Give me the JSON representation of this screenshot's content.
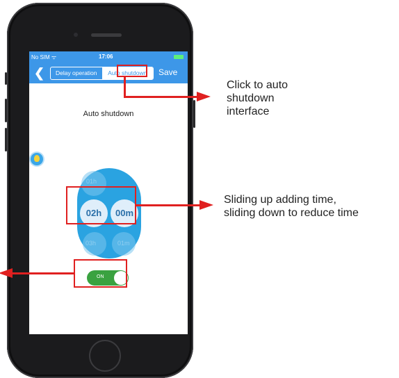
{
  "status_bar": {
    "carrier": "No SIM ᯤ",
    "time": "17:06"
  },
  "nav": {
    "tabs": [
      "Delay operation",
      "Auto shutdown"
    ],
    "active_tab": "Auto shutdown",
    "save_label": "Save"
  },
  "page": {
    "title": "Auto shutdown"
  },
  "picker": {
    "hours": "02h",
    "minutes": "00m",
    "prev_hours": "01h",
    "next_hours": "03h",
    "next_minutes": "01m"
  },
  "toggle": {
    "label": "ON",
    "state": "on"
  },
  "annotations": {
    "top": "Click to auto\nshutdown\ninterface",
    "middle": "Sliding up adding time,\nsliding down to reduce time"
  },
  "colors": {
    "nav_blue": "#3d97e8",
    "picker_blue": "#2aa3e1",
    "toggle_green": "#3aa240",
    "callout_red": "#e02020"
  }
}
